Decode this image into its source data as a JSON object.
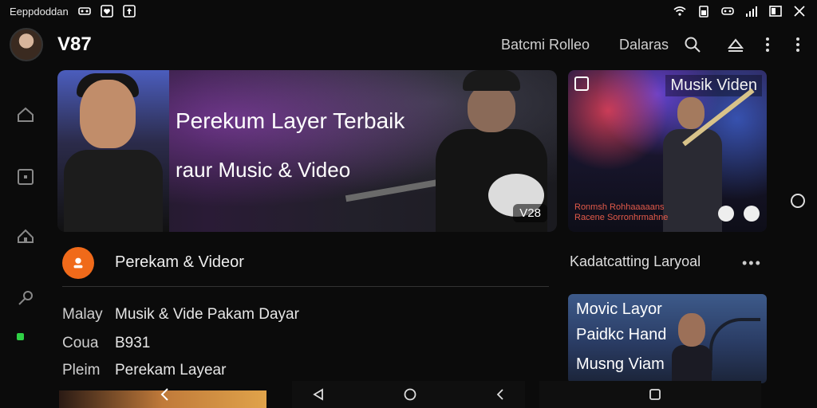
{
  "status": {
    "left_text": "Eeppdoddan"
  },
  "header": {
    "title": "V87",
    "link1": "Batcmi Rolleo",
    "link2": "Dalaras"
  },
  "hero": {
    "title": "Perekum Layer Terbaik",
    "subtitle": "raur Music & Video",
    "badge": "V28"
  },
  "side_card": {
    "title": "Musik Viden",
    "caption_line1": "Ronmsh Rohhaaaaans",
    "caption_line2": "Racene Sorronhrmahne"
  },
  "content": {
    "row_title": "Perekam & Videor",
    "details": [
      {
        "key": "Malay",
        "value": "Musik & Vide Pakam Dayar"
      },
      {
        "key": "Coua",
        "value": "B931"
      },
      {
        "key": "Pleim",
        "value": "Perekam Layear"
      }
    ]
  },
  "side_panel": {
    "heading": "Kadatcatting Laryoal",
    "more": "•••",
    "promo_lines": [
      "Movic Layor",
      "Paidkc Hand",
      "Musng Viam"
    ]
  },
  "colors": {
    "brand": "#f06a1a",
    "indicator": "#2fd045"
  }
}
